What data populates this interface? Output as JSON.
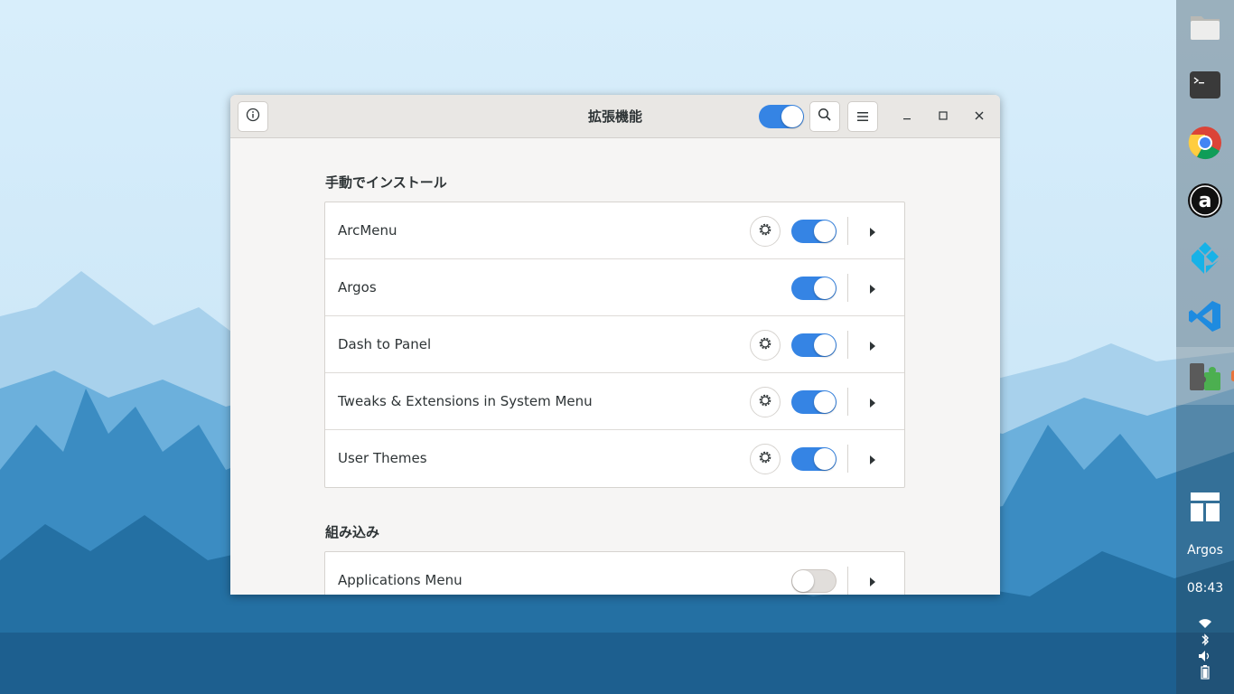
{
  "window": {
    "title": "拡張機能",
    "global_toggle_on": true,
    "buttons": [
      "about-icon",
      "search-icon",
      "menu-icon"
    ],
    "controls": [
      "minimize-icon",
      "maximize-icon",
      "close-icon"
    ]
  },
  "sections": [
    {
      "title": "手動でインストール",
      "items": [
        {
          "name": "ArcMenu",
          "has_settings": true,
          "enabled": true
        },
        {
          "name": "Argos",
          "has_settings": false,
          "enabled": true
        },
        {
          "name": "Dash to Panel",
          "has_settings": true,
          "enabled": true
        },
        {
          "name": "Tweaks & Extensions in System Menu",
          "has_settings": true,
          "enabled": true
        },
        {
          "name": "User Themes",
          "has_settings": true,
          "enabled": true
        }
      ]
    },
    {
      "title": "組み込み",
      "items": [
        {
          "name": "Applications Menu",
          "has_settings": false,
          "enabled": false
        }
      ]
    }
  ],
  "dock": {
    "apps": [
      "files-icon",
      "terminal-icon",
      "chrome-icon",
      "a-app-icon",
      "kodi-icon",
      "vscode-icon",
      "extensions-icon"
    ],
    "layout_icon": "layout-icon",
    "active_label": "Argos",
    "clock": "08:43",
    "tray": [
      "wifi-icon",
      "bluetooth-icon",
      "volume-icon",
      "battery-icon"
    ]
  },
  "colors": {
    "accent": "#3584e4",
    "window_bg": "#f6f5f4"
  }
}
